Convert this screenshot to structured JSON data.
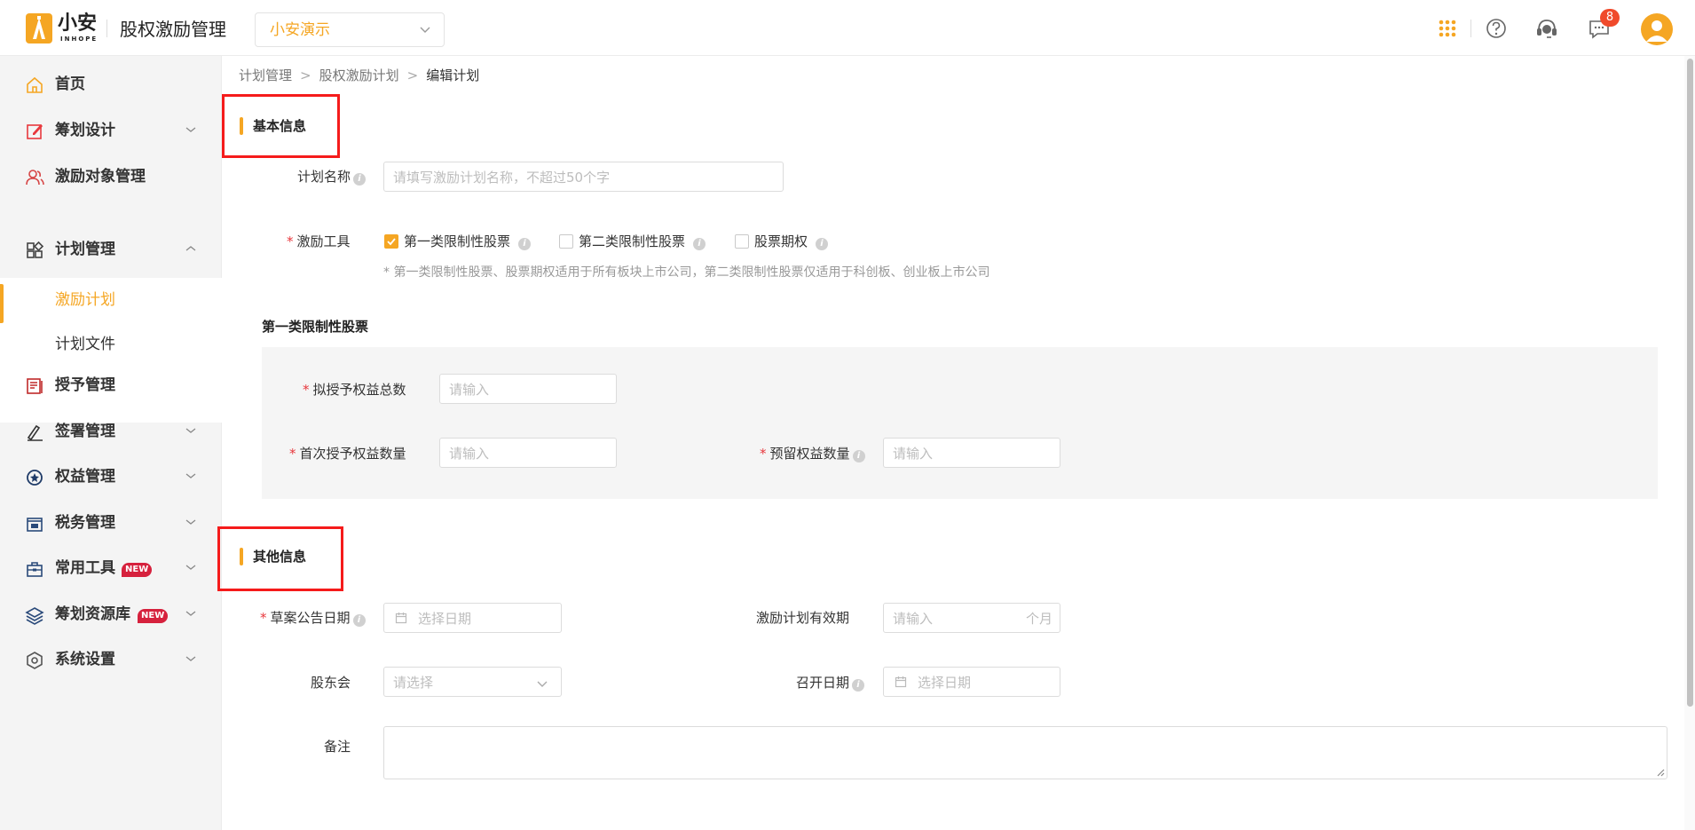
{
  "header": {
    "logo_text": "小安",
    "logo_sub": "INHOPE",
    "app_title": "股权激励管理",
    "company_select": "小安演示",
    "message_count": "8"
  },
  "sidebar": {
    "items": [
      {
        "label": "首页",
        "icon": "home-icon"
      },
      {
        "label": "筹划设计",
        "icon": "edit-icon"
      },
      {
        "label": "激励对象管理",
        "icon": "users-icon"
      },
      {
        "label": "计划管理",
        "icon": "grid-icon"
      },
      {
        "label": "授予管理",
        "icon": "book-icon"
      },
      {
        "label": "签署管理",
        "icon": "sign-icon"
      },
      {
        "label": "权益管理",
        "icon": "shield-icon"
      },
      {
        "label": "税务管理",
        "icon": "tax-icon"
      },
      {
        "label": "常用工具",
        "icon": "toolbox-icon",
        "badge": "NEW"
      },
      {
        "label": "筹划资源库",
        "icon": "layers-icon",
        "badge": "NEW"
      },
      {
        "label": "系统设置",
        "icon": "settings-icon"
      }
    ],
    "sub_items": [
      {
        "label": "激励计划",
        "active": true
      },
      {
        "label": "计划文件",
        "active": false
      }
    ]
  },
  "breadcrumb": [
    "计划管理",
    "股权激励计划",
    "编辑计划"
  ],
  "basic_section": {
    "title": "基本信息",
    "plan_name_label": "计划名称",
    "plan_name_placeholder": "请填写激励计划名称，不超过50个字",
    "tool_label": "激励工具",
    "tools": [
      {
        "label": "第一类限制性股票",
        "checked": true
      },
      {
        "label": "第二类限制性股票",
        "checked": false
      },
      {
        "label": "股票期权",
        "checked": false
      }
    ],
    "tool_hint": "* 第一类限制性股票、股票期权适用于所有板块上市公司，第二类限制性股票仅适用于科创板、创业板上市公司"
  },
  "stock_section": {
    "title": "第一类限制性股票",
    "total_label": "拟授予权益总数",
    "first_label": "首次授予权益数量",
    "reserved_label": "预留权益数量",
    "placeholder": "请输入"
  },
  "other_section": {
    "title": "其他信息",
    "draft_date_label": "草案公告日期",
    "date_placeholder": "选择日期",
    "validity_label": "激励计划有效期",
    "validity_placeholder": "请输入",
    "validity_suffix": "个月",
    "meeting_label": "股东会",
    "meeting_placeholder": "请选择",
    "meeting_date_label": "召开日期",
    "remark_label": "备注"
  },
  "colors": {
    "accent": "#f5a623",
    "highlight_box": "#f51b1b",
    "required": "#e8383d"
  }
}
